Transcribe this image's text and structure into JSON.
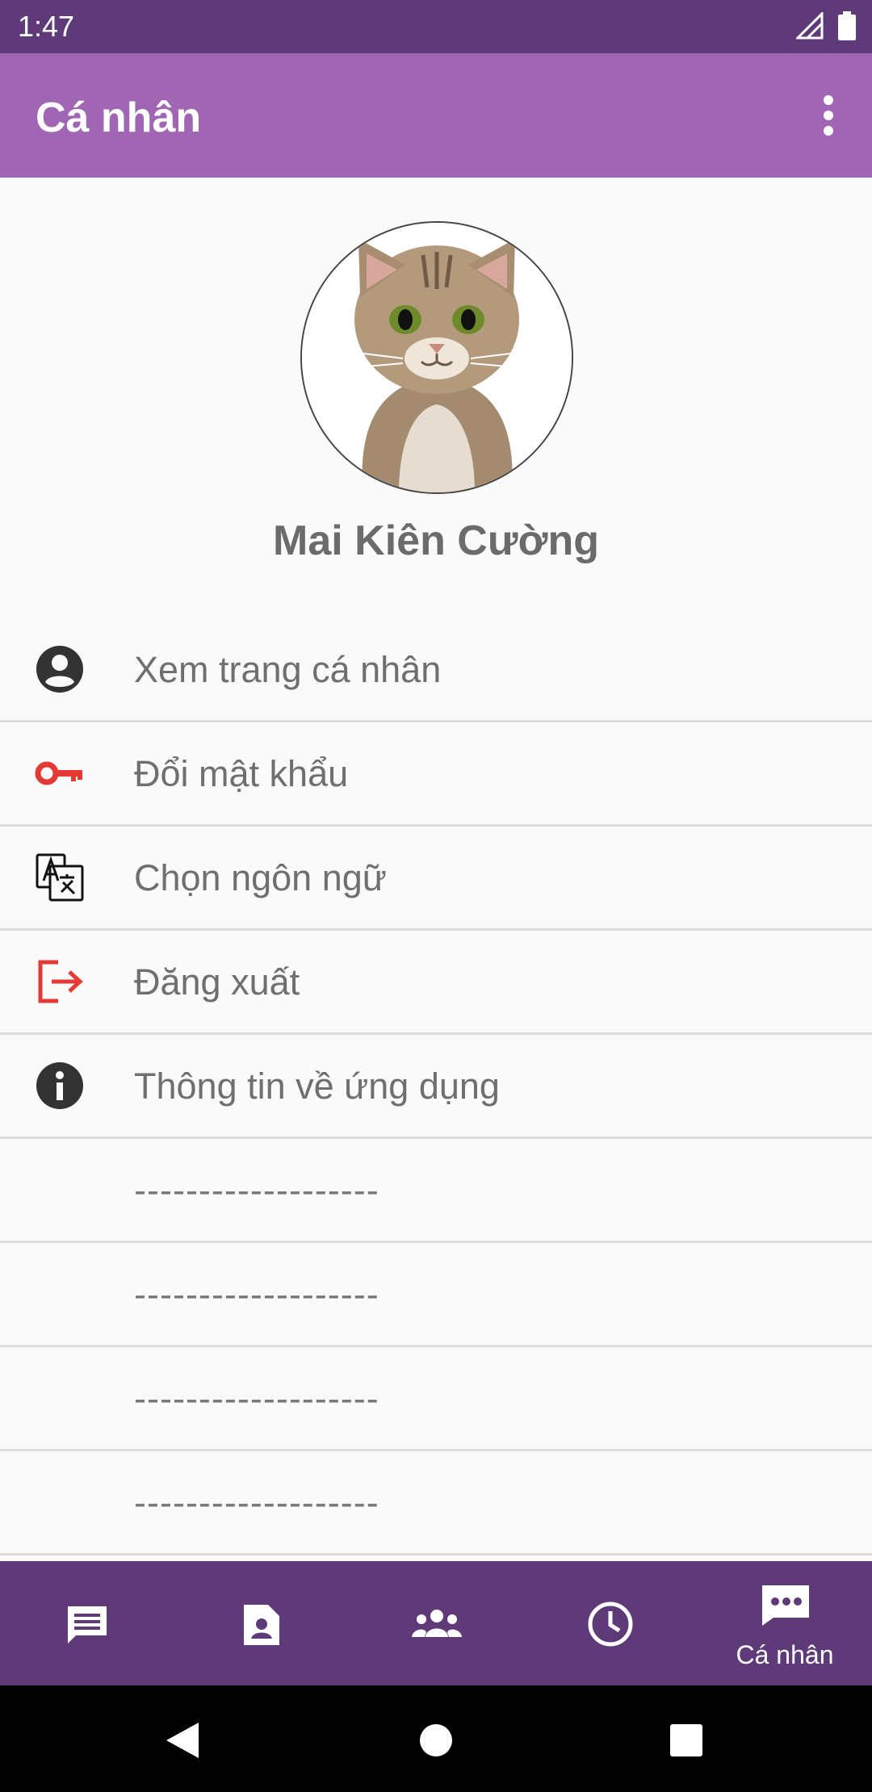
{
  "status_bar": {
    "time": "1:47"
  },
  "app_bar": {
    "title": "Cá nhân"
  },
  "profile": {
    "name": "Mai Kiên Cường"
  },
  "menu": {
    "items": [
      {
        "label": "Xem trang cá nhân",
        "icon": "account-circle-icon"
      },
      {
        "label": "Đổi mật khẩu",
        "icon": "key-icon"
      },
      {
        "label": "Chọn ngôn ngữ",
        "icon": "translate-icon"
      },
      {
        "label": "Đăng xuất",
        "icon": "logout-icon"
      },
      {
        "label": "Thông tin về ứng dụng",
        "icon": "info-icon"
      },
      {
        "label": "-------------------"
      },
      {
        "label": "-------------------"
      },
      {
        "label": "-------------------"
      },
      {
        "label": "-------------------"
      }
    ]
  },
  "bottom_nav": {
    "items": [
      {
        "icon": "chat-icon"
      },
      {
        "icon": "contact-card-icon"
      },
      {
        "icon": "group-icon"
      },
      {
        "icon": "clock-icon"
      },
      {
        "icon": "more-chat-icon",
        "label": "Cá nhân"
      }
    ]
  },
  "colors": {
    "status_bar": "#5e3a78",
    "app_bar": "#a066b3",
    "bottom_nav": "#5e3a78",
    "accent_red": "#e53935"
  }
}
